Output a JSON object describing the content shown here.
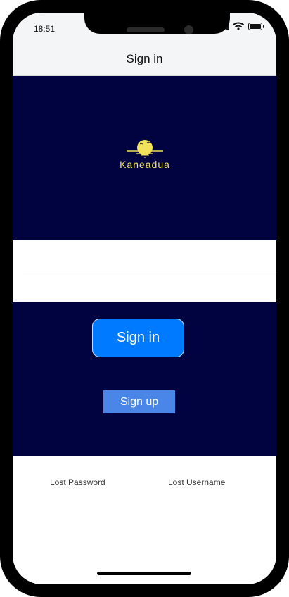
{
  "status_bar": {
    "time": "18:51",
    "icons": [
      "signal-icon",
      "wifi-icon",
      "battery-icon"
    ]
  },
  "header": {
    "title": "Sign in"
  },
  "logo": {
    "text": "Kaneadua",
    "colors": {
      "sun": "#f3e35a",
      "background": "#000340"
    }
  },
  "form": {
    "username": {
      "value": "",
      "placeholder": ""
    },
    "password": {
      "value": "",
      "placeholder": ""
    }
  },
  "buttons": {
    "signin_label": "Sign in",
    "signup_label": "Sign up"
  },
  "links": {
    "lost_password": "Lost Password",
    "lost_username": "Lost Username"
  },
  "colors": {
    "hero_background": "#000340",
    "signin_button": "#007bff",
    "signup_button": "#4a86e8",
    "header_background": "#f4f5f7"
  }
}
